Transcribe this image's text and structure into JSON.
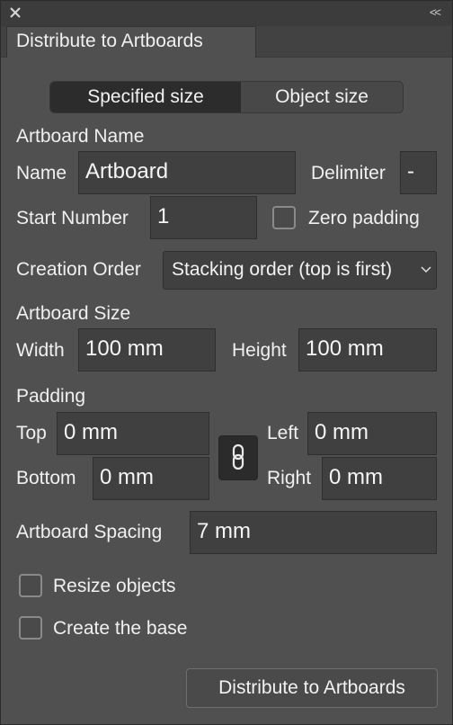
{
  "titlebar": {
    "close_icon": "close-icon",
    "collapse_label": "<<"
  },
  "tab": {
    "label": "Distribute to Artboards"
  },
  "mode": {
    "options": [
      "Specified size",
      "Object size"
    ],
    "selected": "Specified size"
  },
  "artboard_name": {
    "section_label": "Artboard Name",
    "name_label": "Name",
    "name_value": "Artboard",
    "delimiter_label": "Delimiter",
    "delimiter_value": "-",
    "start_number_label": "Start Number",
    "start_number_value": "1",
    "zero_padding_label": "Zero padding",
    "zero_padding_checked": false
  },
  "creation_order": {
    "label": "Creation Order",
    "selected": "Stacking order (top is first)"
  },
  "artboard_size": {
    "section_label": "Artboard Size",
    "width_label": "Width",
    "width_value": "100 mm",
    "height_label": "Height",
    "height_value": "100 mm"
  },
  "padding": {
    "section_label": "Padding",
    "top_label": "Top",
    "top_value": "0 mm",
    "bottom_label": "Bottom",
    "bottom_value": "0 mm",
    "left_label": "Left",
    "left_value": "0 mm",
    "right_label": "Right",
    "right_value": "0 mm",
    "link_icon": "link-icon"
  },
  "spacing": {
    "label": "Artboard Spacing",
    "value": "7 mm"
  },
  "options": {
    "resize_objects_label": "Resize objects",
    "resize_objects_checked": false,
    "create_base_label": "Create the base",
    "create_base_checked": false
  },
  "action": {
    "button_label": "Distribute to Artboards"
  }
}
